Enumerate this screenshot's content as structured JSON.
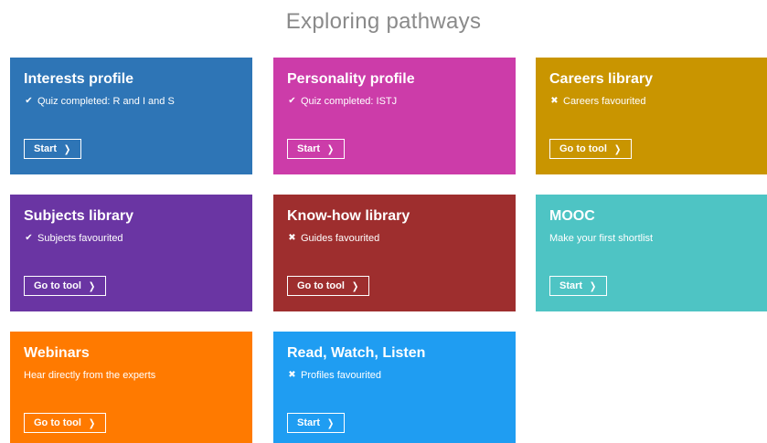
{
  "page": {
    "title": "Exploring pathways"
  },
  "tiles": [
    {
      "title": "Interests profile",
      "status_icon": "check-icon",
      "status_glyph": "✔",
      "status": "Quiz completed: R and I and S",
      "button": "Start",
      "color": "#2e75b6"
    },
    {
      "title": "Personality profile",
      "status_icon": "check-icon",
      "status_glyph": "✔",
      "status": "Quiz completed: ISTJ",
      "button": "Start",
      "color": "#cc3ca9"
    },
    {
      "title": "Careers library",
      "status_icon": "cross-icon",
      "status_glyph": "✖",
      "status": "Careers favourited",
      "button": "Go to tool",
      "color": "#c99500"
    },
    {
      "title": "Subjects library",
      "status_icon": "check-icon",
      "status_glyph": "✔",
      "status": "Subjects favourited",
      "button": "Go to tool",
      "color": "#6a35a3"
    },
    {
      "title": "Know-how library",
      "status_icon": "cross-icon",
      "status_glyph": "✖",
      "status": "Guides favourited",
      "button": "Go to tool",
      "color": "#9e2e2e"
    },
    {
      "title": "MOOC",
      "status_icon": "",
      "status_glyph": "",
      "status": "Make your first shortlist",
      "button": "Start",
      "color": "#4ec4c4"
    },
    {
      "title": "Webinars",
      "status_icon": "",
      "status_glyph": "",
      "status": "Hear directly from the experts",
      "button": "Go to tool",
      "color": "#ff7a00"
    },
    {
      "title": "Read, Watch, Listen",
      "status_icon": "cross-icon",
      "status_glyph": "✖",
      "status": "Profiles favourited",
      "button": "Start",
      "color": "#1f9df2"
    }
  ],
  "chevron_glyph": "❯"
}
